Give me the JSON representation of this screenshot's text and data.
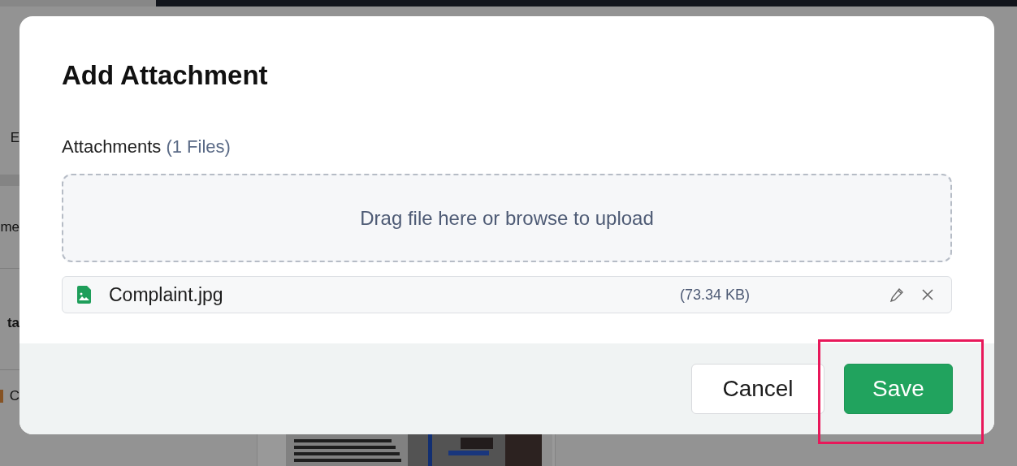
{
  "background": {
    "fragments": [
      {
        "text": "E",
        "bold": false
      },
      {
        "text": "me",
        "bold": false
      },
      {
        "text": "ta",
        "bold": true
      },
      {
        "text": "C",
        "bold": false
      }
    ]
  },
  "dialog": {
    "title": "Add Attachment",
    "label": "Attachments",
    "count": "(1 Files)",
    "dropzone": "Drag file here or browse to upload",
    "files": [
      {
        "name": "Complaint.jpg",
        "size": "(73.34 KB)"
      }
    ],
    "buttons": [
      {
        "label": "Cancel",
        "kind": "secondary",
        "highlighted": false
      },
      {
        "label": "Save",
        "kind": "primary",
        "highlighted": true
      }
    ]
  }
}
